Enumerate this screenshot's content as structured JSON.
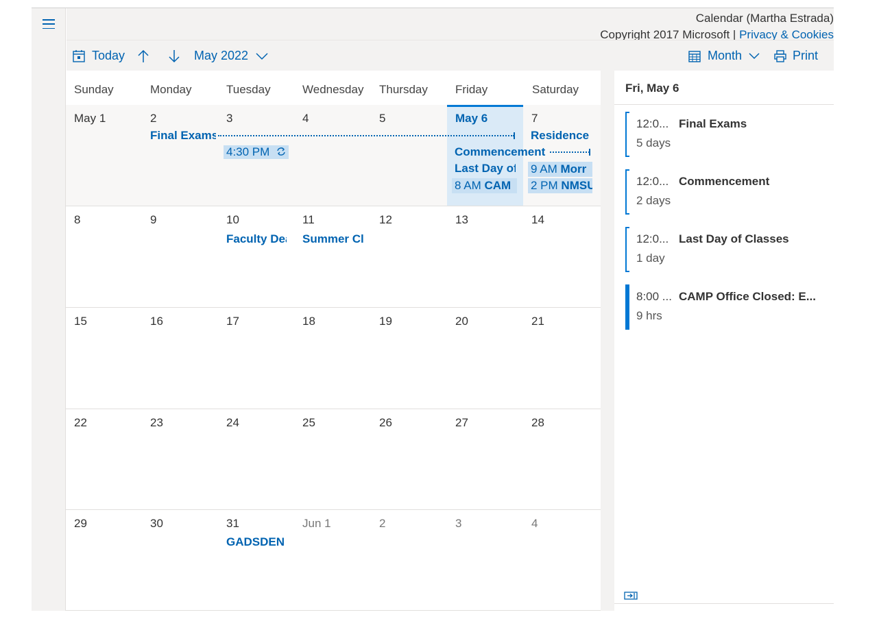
{
  "header": {
    "title": "Calendar (Martha Estrada)",
    "copyright": "Copyright 2017 Microsoft | ",
    "privacy_link": "Privacy & Cookies"
  },
  "toolbar": {
    "today_label": "Today",
    "month_label": "May 2022",
    "view_label": "Month",
    "print_label": "Print"
  },
  "weekdays": [
    "Sunday",
    "Monday",
    "Tuesday",
    "Wednesday",
    "Thursday",
    "Friday",
    "Saturday"
  ],
  "weeks": [
    [
      "May 1",
      "2",
      "3",
      "4",
      "5",
      "May 6",
      "7"
    ],
    [
      "8",
      "9",
      "10",
      "11",
      "12",
      "13",
      "14"
    ],
    [
      "15",
      "16",
      "17",
      "18",
      "19",
      "20",
      "21"
    ],
    [
      "22",
      "23",
      "24",
      "25",
      "26",
      "27",
      "28"
    ],
    [
      "29",
      "30",
      "31",
      "Jun 1",
      "2",
      "3",
      "4"
    ]
  ],
  "events": {
    "final_exams": "Final Exams",
    "tue_430_time": "4:30 PM",
    "commencement": "Commencement",
    "residence": "Residence",
    "last_day": "Last Day of",
    "cam_time": "8 AM",
    "cam_subject": "CAM",
    "morn_time": "9 AM",
    "morn_subject": "Morr",
    "nms_time": "2 PM",
    "nms_subject": "NMSU",
    "faculty": "Faculty Dea",
    "summer": "Summer Cl",
    "gadsden": "GADSDEN"
  },
  "agenda": {
    "heading": "Fri, May 6",
    "items": [
      {
        "time": "12:0...",
        "subject": "Final Exams",
        "duration": "5 days"
      },
      {
        "time": "12:0...",
        "subject": "Commencement",
        "duration": "2 days"
      },
      {
        "time": "12:0...",
        "subject": "Last Day of Classes",
        "duration": "1 day"
      },
      {
        "time": "8:00 ...",
        "subject": "CAMP Office Closed: E...",
        "duration": "9 hrs"
      }
    ]
  },
  "colors": {
    "accent": "#0078d4",
    "link": "#0063b1",
    "today_bg": "#daeaf7",
    "event_bg": "#c7dff3",
    "chrome_bg": "#f3f2f1"
  },
  "icons": {
    "menu": "hamburger-icon",
    "today": "calendar-today-icon",
    "prev": "arrow-up-icon",
    "next": "arrow-down-icon",
    "month_picker": "chevron-down-icon",
    "view": "calendar-grid-icon",
    "print": "printer-icon",
    "recurring": "recurring-icon",
    "collapse": "collapse-pane-icon"
  }
}
